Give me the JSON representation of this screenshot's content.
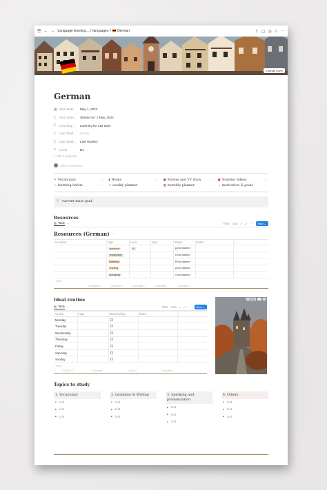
{
  "topbar": {
    "breadcrumb_1": "Language learning...",
    "separator": "/",
    "breadcrumb_2": "languages",
    "separator_2": "/",
    "breadcrumb_3": "German"
  },
  "cover": {
    "change_cover_label": "Change cover",
    "flag_colors": [
      "#000000",
      "#dd0000",
      "#ffce00"
    ]
  },
  "page_title": "German",
  "properties": [
    {
      "icon": "calendar-icon",
      "name": "Start Date",
      "value": "May 1, 2022"
    },
    {
      "icon": "sigma-icon",
      "name": "Start Date...",
      "value": "Started on: 1 May, 2022"
    },
    {
      "icon": "sigma-icon",
      "name": "Learning ...",
      "value": "Learning for 218 days"
    },
    {
      "icon": "sigma-icon",
      "name": "Last Studi...",
      "value": "Empty",
      "muted": true
    },
    {
      "icon": "sigma-icon",
      "name": "Last Studi...",
      "value": "Last studied:"
    },
    {
      "icon": "list-icon",
      "name": "Level",
      "value": "B1"
    }
  ],
  "add_property_label": "+ Add a property",
  "add_comment_label": "Add a comment...",
  "quick_links": [
    {
      "icon": "🔗",
      "label": "Vocabulary"
    },
    {
      "icon": "📗",
      "label": "Books"
    },
    {
      "icon": "🎬",
      "label": "Movies and TV show"
    },
    {
      "icon": "▶",
      "label": "Youtube videos"
    },
    {
      "icon": "✏",
      "label": "learning habits"
    },
    {
      "icon": "🔗",
      "label": "weekly planner"
    },
    {
      "icon": "📅",
      "label": "monthly planner"
    },
    {
      "icon": "🔥",
      "label": "motivation & goals"
    }
  ],
  "goal_callout": "current main goal:",
  "resources": {
    "heading": "Resources",
    "view_label": "Table",
    "filter": "Filter",
    "sort": "Sort",
    "new": "New",
    "db_title": "Resources (German)",
    "columns": [
      "Aa Name",
      "Tags",
      "Level",
      "Type",
      "Status",
      "Notes",
      "+"
    ],
    "rows": [
      {
        "tag": "grammar",
        "tag_color": "#fbecdd",
        "level": "A1",
        "status": "Not started"
      },
      {
        "tag": "vocabulary",
        "tag_color": "#dbeddb",
        "level": "",
        "status": "Not started"
      },
      {
        "tag": "listening",
        "tag_color": "#fadec9",
        "level": "",
        "status": "Not started"
      },
      {
        "tag": "reading",
        "tag_color": "#fdecc8",
        "level": "",
        "status": "Not started"
      },
      {
        "tag": "speaking",
        "tag_color": "#e8deee",
        "level": "",
        "status": "Not started"
      }
    ],
    "new_row": "+ New",
    "calc": [
      "Calculate ⌄",
      "Calculate ⌄",
      "Calculate ⌄",
      "Calculate ⌄",
      "Calculate ⌄"
    ]
  },
  "routine": {
    "heading": "Ideal routine",
    "view_label": "Table",
    "filter": "Filter",
    "sort": "Sort",
    "new": "New",
    "columns": [
      "Aa Day",
      "Tags",
      "Mastery/day",
      "Notes",
      "+"
    ],
    "days": [
      "Monday",
      "Tuesday",
      "Wednesday",
      "Thursday",
      "Friday",
      "Saturday",
      "Sunday"
    ],
    "new_row": "+ New",
    "calc": [
      "COUNT 7",
      "Calculate ⌄",
      "SUM 0",
      "Calculate ⌄"
    ],
    "photo_buttons": [
      "Change",
      "···",
      "×"
    ]
  },
  "topics": {
    "heading": "Topics to study",
    "columns": [
      {
        "title": "1.  Vocabulary",
        "bg": "#f1f1ef",
        "items": [
          "List",
          "List",
          "List"
        ]
      },
      {
        "title": "2.  Grammar & Writing",
        "bg": "#f1f1ef",
        "items": [
          "List",
          "List",
          "List"
        ]
      },
      {
        "title": "3.  Speaking and pronunciation",
        "bg": "#f1f1ef",
        "items": [
          "List",
          "List",
          "List"
        ]
      },
      {
        "title": "4.  Others",
        "bg": "#f7eded",
        "items": [
          "List",
          "List",
          "List"
        ]
      }
    ]
  }
}
